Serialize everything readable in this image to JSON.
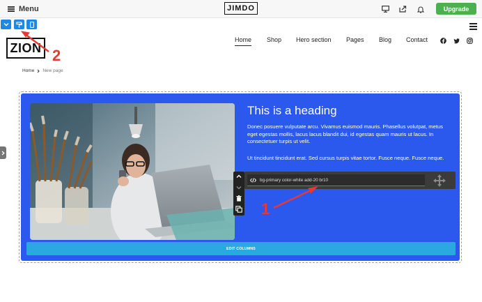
{
  "topbar": {
    "menu_label": "Menu",
    "brand": "JIMDO",
    "upgrade_label": "Upgrade"
  },
  "site": {
    "logo": "ZION",
    "nav": [
      "Home",
      "Shop",
      "Hero section",
      "Pages",
      "Blog",
      "Contact"
    ],
    "breadcrumb": {
      "home": "Home",
      "current": "New page"
    }
  },
  "section": {
    "heading": "This is a heading",
    "paragraph1": "Donec posuere vulputate arcu. Vivamus euismod mauris. Phasellus volutpat, metus eget egestas mollis, lacus lacus blandit dui, id egestas quam mauris ut lacus. In consectetuer turpis ut velit.",
    "paragraph2": "Ut tincidunt tincidunt erat. Sed cursus turpis vitae tortor. Fusce neque. Fusce neque.",
    "classes": "bg-primary color-white add-20 br10",
    "edit_columns_label": "EDIT COLUMNS"
  },
  "annotations": {
    "one": "1",
    "two": "2"
  },
  "colors": {
    "section_bg": "#2b59ee",
    "upgrade": "#4caf50",
    "edit_columns": "#29a9e0",
    "annotation": "#e53935"
  },
  "icons": [
    "hamburger-icon",
    "desktop-icon",
    "share-icon",
    "bell-icon",
    "chevron-down-icon",
    "paint-roller-icon",
    "mobile-icon",
    "chevron-right-icon",
    "facebook-icon",
    "twitter-icon",
    "instagram-icon",
    "code-icon",
    "chevron-up-icon",
    "trash-icon",
    "duplicate-icon",
    "move-icon"
  ]
}
